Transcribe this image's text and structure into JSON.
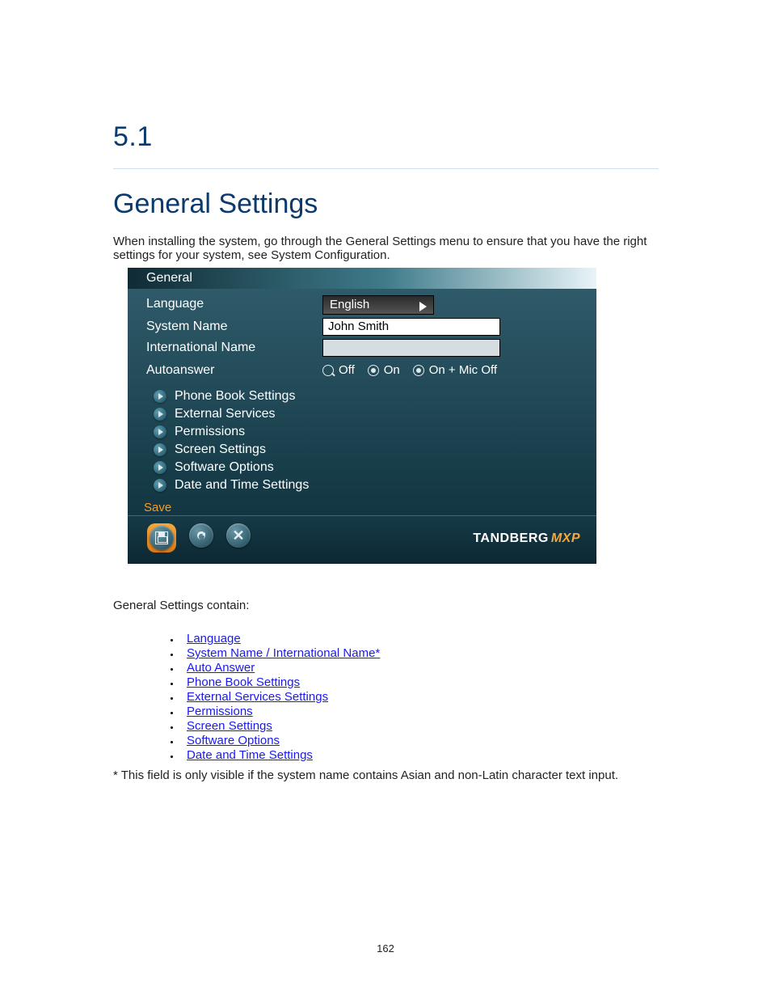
{
  "section": {
    "number": "5.1",
    "title": "General Settings"
  },
  "intro": "When installing the system, go through the General Settings menu to ensure that you have the right settings for your system, see System Configuration.",
  "screenshot": {
    "header": "General",
    "labels": {
      "language": "Language",
      "system_name": "System Name",
      "international_name": "International Name",
      "autoanswer": "Autoanswer"
    },
    "language_value": "English",
    "system_name_value": "John Smith",
    "international_name_value": "",
    "autoanswer_options": {
      "off": "Off",
      "on": "On",
      "on_mic_off": "On + Mic Off"
    },
    "nav_items": [
      "Phone Book Settings",
      "External Services",
      "Permissions",
      "Screen Settings",
      "Software Options",
      "Date and Time Settings"
    ],
    "save": "Save",
    "brand": {
      "name": "TANDBERG",
      "suffix": "MXP"
    }
  },
  "links_intro": "General Settings contain:",
  "links": [
    "Language",
    "System Name / International Name*",
    "Auto Answer",
    "Phone Book Settings",
    "External Services Settings",
    "Permissions",
    "Screen Settings",
    "Software Options",
    "Date and Time Settings"
  ],
  "footnote": "* This field is only visible if the system name contains Asian and non-Latin character text input.",
  "pagenum": "162"
}
